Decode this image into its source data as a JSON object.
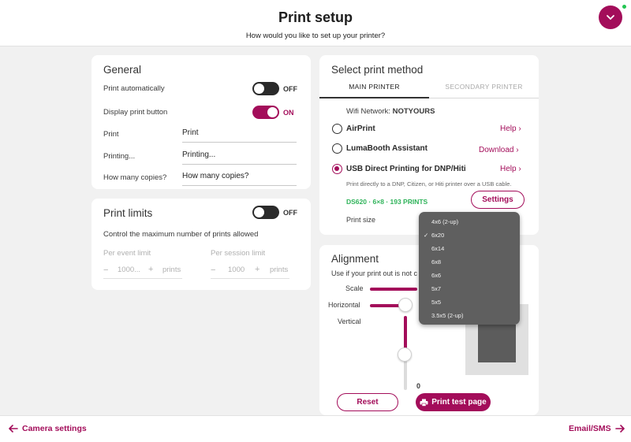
{
  "header": {
    "title": "Print setup",
    "subtitle": "How would you like to set up your printer?"
  },
  "general": {
    "title": "General",
    "print_automatically": {
      "label": "Print automatically",
      "state": "OFF"
    },
    "display_print_button": {
      "label": "Display print button",
      "state": "ON"
    },
    "fields": [
      {
        "label": "Print",
        "value": "Print"
      },
      {
        "label": "Printing...",
        "value": "Printing..."
      },
      {
        "label": "How many copies?",
        "value": "How many copies?"
      }
    ]
  },
  "print_limits": {
    "title": "Print limits",
    "state": "OFF",
    "description": "Control the maximum number of prints allowed",
    "per_event": {
      "label": "Per event limit",
      "value": "1000...",
      "unit": "prints",
      "minus": "−",
      "plus": "+"
    },
    "per_session": {
      "label": "Per session limit",
      "value": "1000",
      "unit": "prints",
      "minus": "−",
      "plus": "+"
    }
  },
  "print_method": {
    "title": "Select print method",
    "tabs": [
      "MAIN PRINTER",
      "SECONDARY PRINTER"
    ],
    "active_tab": 0,
    "wifi_label": "Wifi Network:",
    "wifi_name": "NOTYOURS",
    "options": [
      {
        "label": "AirPrint",
        "link": "Help"
      },
      {
        "label": "LumaBooth Assistant",
        "link": "Download"
      },
      {
        "label": "USB Direct Printing for DNP/Hiti",
        "link": "Help"
      }
    ],
    "selected_option": 2,
    "usb_description": "Print directly to a DNP, Citizen, or Hiti printer over a USB cable.",
    "printer_status": "DS620 · 6×8 · 193 PRINTS",
    "settings_button": "Settings",
    "print_size_label": "Print size",
    "print_size_options": [
      "4x6 (2-up)",
      "6x20",
      "6x14",
      "6x8",
      "6x6",
      "5x7",
      "5x5",
      "3.5x5 (2-up)"
    ],
    "print_size_selected": "6x20"
  },
  "alignment": {
    "title": "Alignment",
    "description": "Use if your print out is not c",
    "scale_label": "Scale",
    "horizontal_label": "Horizontal",
    "vertical_label": "Vertical",
    "vertical_value": "0",
    "reset_button": "Reset",
    "test_button": "Print test page"
  },
  "footer": {
    "back_label": "Camera settings",
    "next_label": "Email/SMS"
  },
  "colors": {
    "accent": "#a30d5a",
    "status_green": "#2fb35a"
  }
}
